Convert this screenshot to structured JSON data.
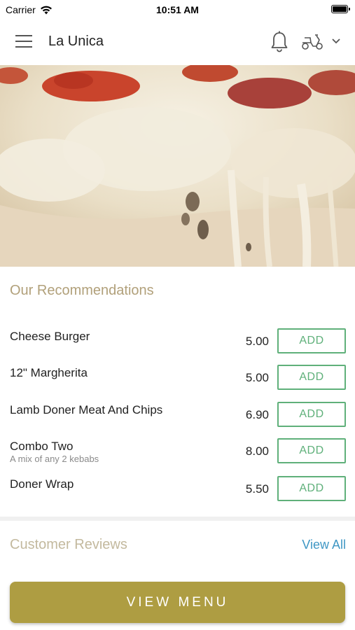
{
  "status_bar": {
    "carrier": "Carrier",
    "time": "10:51 AM"
  },
  "header": {
    "title": "La Unica"
  },
  "recommendations": {
    "title": "Our Recommendations",
    "add_label": "ADD",
    "items": [
      {
        "name": "Cheese Burger",
        "description": "",
        "price": "5.00"
      },
      {
        "name": "12\" Margherita",
        "description": "",
        "price": "5.00"
      },
      {
        "name": "Lamb Doner Meat And Chips",
        "description": "",
        "price": "6.90"
      },
      {
        "name": "Combo Two",
        "description": "A mix of any 2 kebabs",
        "price": "8.00"
      },
      {
        "name": "Doner Wrap",
        "description": "",
        "price": "5.50"
      }
    ]
  },
  "reviews": {
    "title": "Customer Reviews",
    "view_all": "View All"
  },
  "footer": {
    "view_menu": "VIEW MENU"
  },
  "colors": {
    "accent": "#ae9d42",
    "section_title": "#b1a07a",
    "add_green": "#5fb07a",
    "link_blue": "#3f97c4"
  }
}
